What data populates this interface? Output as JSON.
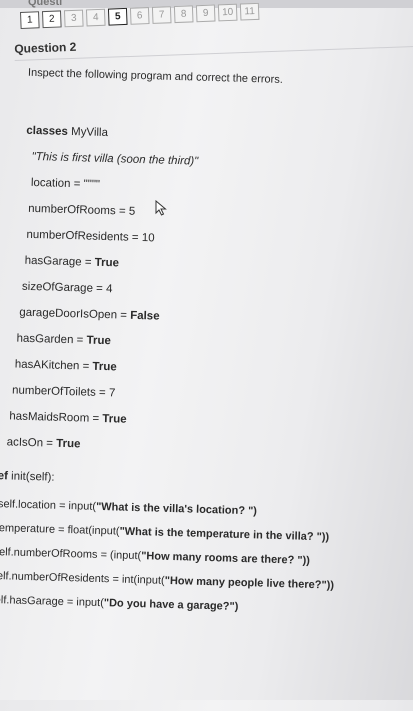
{
  "header": {
    "tab_label": "Questi",
    "question_label": "Question 2",
    "question_numbers": [
      {
        "label": "1",
        "state": "done"
      },
      {
        "label": "2",
        "state": "done"
      },
      {
        "label": "3",
        "state": "dim"
      },
      {
        "label": "4",
        "state": "dim"
      },
      {
        "label": "5",
        "state": "current"
      },
      {
        "label": "6",
        "state": "dim"
      },
      {
        "label": "7",
        "state": "dim"
      },
      {
        "label": "8",
        "state": "dim"
      },
      {
        "label": "9",
        "state": "dim"
      },
      {
        "label": "10",
        "state": "dim"
      },
      {
        "label": "11",
        "state": "dim"
      }
    ]
  },
  "instruction": "Inspect the following program and correct the errors.",
  "code": {
    "class_decl": {
      "keyword": "classes",
      "name": " MyVilla"
    },
    "docstring": "\"This is first villa (soon the third)\"",
    "assignments": [
      {
        "name": "location = ",
        "value": "\"\"\"\""
      },
      {
        "name": "numberOfRooms = ",
        "value": "5"
      },
      {
        "name": "numberOfResidents = ",
        "value": "10"
      },
      {
        "name": "hasGarage = ",
        "value": "True"
      },
      {
        "name": "sizeOfGarage = ",
        "value": "4"
      },
      {
        "name": "garageDoorIsOpen = ",
        "value": "False"
      },
      {
        "name": "hasGarden = ",
        "value": "True"
      },
      {
        "name": "hasAKitchen = ",
        "value": "True"
      },
      {
        "name": "numberOfToilets = ",
        "value": "7"
      },
      {
        "name": "hasMaidsRoom = ",
        "value": "True"
      },
      {
        "name": "acIsOn = ",
        "value": "True"
      }
    ],
    "def_line": {
      "keyword": "def",
      "rest": " init(self):"
    },
    "body": [
      {
        "lhs": "self.location = input(",
        "arg": "\"What is the villa's location? \")"
      },
      {
        "lhs": "temperature = float(input(",
        "arg": "\"What is the temperature in the villa? \"))"
      },
      {
        "lhs": "self.numberOfRooms = (input(",
        "arg": "\"How many rooms are there? \"))"
      },
      {
        "lhs": "self.numberOfResidents = int(input(",
        "arg": "\"How many people live there?\"))"
      },
      {
        "lhs": "self.hasGarage = input(",
        "arg": "\"Do you have a garage?\")"
      }
    ]
  }
}
